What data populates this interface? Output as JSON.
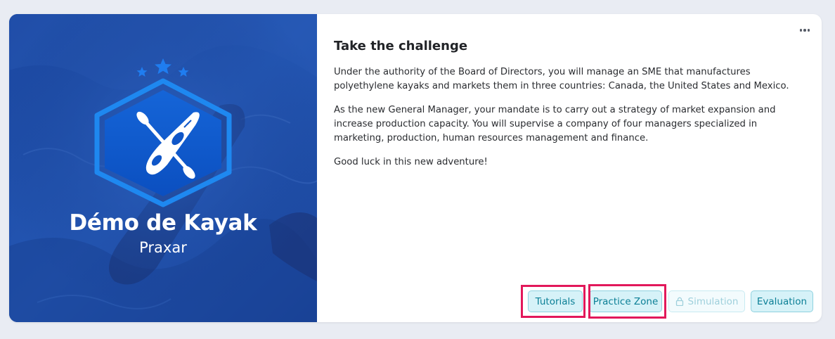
{
  "course": {
    "title": "Démo de Kayak",
    "subtitle": "Praxar"
  },
  "content": {
    "heading": "Take the challenge",
    "paragraphs": [
      "Under the authority of the Board of Directors, you will manage an SME that manufactures polyethylene kayaks and markets them in three countries: Canada, the United States and Mexico.",
      "As the new General Manager, your mandate is to carry out a strategy of market expansion and increase production capacity. You will supervise a company of four managers specialized in marketing, production, human resources management and finance.",
      "Good luck in this new adventure!"
    ]
  },
  "actions": {
    "tutorials": "Tutorials",
    "practice_zone": "Practice Zone",
    "simulation": "Simulation",
    "evaluation": "Evaluation"
  },
  "icons": {
    "more": "more-horizontal-icon",
    "lock": "lock-icon",
    "logo": "kayak-hexagon-logo",
    "stars": "star-icon"
  },
  "colors": {
    "hero_blue": "#1f4ea8",
    "button_text": "#0b7f96",
    "button_bg": "#d6f2f8",
    "highlight": "#e2185a"
  }
}
